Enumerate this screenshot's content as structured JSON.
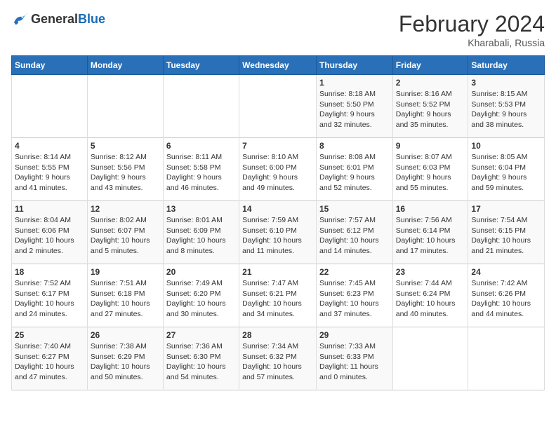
{
  "logo": {
    "general": "General",
    "blue": "Blue"
  },
  "title": "February 2024",
  "subtitle": "Kharabali, Russia",
  "days_header": [
    "Sunday",
    "Monday",
    "Tuesday",
    "Wednesday",
    "Thursday",
    "Friday",
    "Saturday"
  ],
  "weeks": [
    [
      {
        "day": "",
        "info": ""
      },
      {
        "day": "",
        "info": ""
      },
      {
        "day": "",
        "info": ""
      },
      {
        "day": "",
        "info": ""
      },
      {
        "day": "1",
        "info": "Sunrise: 8:18 AM\nSunset: 5:50 PM\nDaylight: 9 hours\nand 32 minutes."
      },
      {
        "day": "2",
        "info": "Sunrise: 8:16 AM\nSunset: 5:52 PM\nDaylight: 9 hours\nand 35 minutes."
      },
      {
        "day": "3",
        "info": "Sunrise: 8:15 AM\nSunset: 5:53 PM\nDaylight: 9 hours\nand 38 minutes."
      }
    ],
    [
      {
        "day": "4",
        "info": "Sunrise: 8:14 AM\nSunset: 5:55 PM\nDaylight: 9 hours\nand 41 minutes."
      },
      {
        "day": "5",
        "info": "Sunrise: 8:12 AM\nSunset: 5:56 PM\nDaylight: 9 hours\nand 43 minutes."
      },
      {
        "day": "6",
        "info": "Sunrise: 8:11 AM\nSunset: 5:58 PM\nDaylight: 9 hours\nand 46 minutes."
      },
      {
        "day": "7",
        "info": "Sunrise: 8:10 AM\nSunset: 6:00 PM\nDaylight: 9 hours\nand 49 minutes."
      },
      {
        "day": "8",
        "info": "Sunrise: 8:08 AM\nSunset: 6:01 PM\nDaylight: 9 hours\nand 52 minutes."
      },
      {
        "day": "9",
        "info": "Sunrise: 8:07 AM\nSunset: 6:03 PM\nDaylight: 9 hours\nand 55 minutes."
      },
      {
        "day": "10",
        "info": "Sunrise: 8:05 AM\nSunset: 6:04 PM\nDaylight: 9 hours\nand 59 minutes."
      }
    ],
    [
      {
        "day": "11",
        "info": "Sunrise: 8:04 AM\nSunset: 6:06 PM\nDaylight: 10 hours\nand 2 minutes."
      },
      {
        "day": "12",
        "info": "Sunrise: 8:02 AM\nSunset: 6:07 PM\nDaylight: 10 hours\nand 5 minutes."
      },
      {
        "day": "13",
        "info": "Sunrise: 8:01 AM\nSunset: 6:09 PM\nDaylight: 10 hours\nand 8 minutes."
      },
      {
        "day": "14",
        "info": "Sunrise: 7:59 AM\nSunset: 6:10 PM\nDaylight: 10 hours\nand 11 minutes."
      },
      {
        "day": "15",
        "info": "Sunrise: 7:57 AM\nSunset: 6:12 PM\nDaylight: 10 hours\nand 14 minutes."
      },
      {
        "day": "16",
        "info": "Sunrise: 7:56 AM\nSunset: 6:14 PM\nDaylight: 10 hours\nand 17 minutes."
      },
      {
        "day": "17",
        "info": "Sunrise: 7:54 AM\nSunset: 6:15 PM\nDaylight: 10 hours\nand 21 minutes."
      }
    ],
    [
      {
        "day": "18",
        "info": "Sunrise: 7:52 AM\nSunset: 6:17 PM\nDaylight: 10 hours\nand 24 minutes."
      },
      {
        "day": "19",
        "info": "Sunrise: 7:51 AM\nSunset: 6:18 PM\nDaylight: 10 hours\nand 27 minutes."
      },
      {
        "day": "20",
        "info": "Sunrise: 7:49 AM\nSunset: 6:20 PM\nDaylight: 10 hours\nand 30 minutes."
      },
      {
        "day": "21",
        "info": "Sunrise: 7:47 AM\nSunset: 6:21 PM\nDaylight: 10 hours\nand 34 minutes."
      },
      {
        "day": "22",
        "info": "Sunrise: 7:45 AM\nSunset: 6:23 PM\nDaylight: 10 hours\nand 37 minutes."
      },
      {
        "day": "23",
        "info": "Sunrise: 7:44 AM\nSunset: 6:24 PM\nDaylight: 10 hours\nand 40 minutes."
      },
      {
        "day": "24",
        "info": "Sunrise: 7:42 AM\nSunset: 6:26 PM\nDaylight: 10 hours\nand 44 minutes."
      }
    ],
    [
      {
        "day": "25",
        "info": "Sunrise: 7:40 AM\nSunset: 6:27 PM\nDaylight: 10 hours\nand 47 minutes."
      },
      {
        "day": "26",
        "info": "Sunrise: 7:38 AM\nSunset: 6:29 PM\nDaylight: 10 hours\nand 50 minutes."
      },
      {
        "day": "27",
        "info": "Sunrise: 7:36 AM\nSunset: 6:30 PM\nDaylight: 10 hours\nand 54 minutes."
      },
      {
        "day": "28",
        "info": "Sunrise: 7:34 AM\nSunset: 6:32 PM\nDaylight: 10 hours\nand 57 minutes."
      },
      {
        "day": "29",
        "info": "Sunrise: 7:33 AM\nSunset: 6:33 PM\nDaylight: 11 hours\nand 0 minutes."
      },
      {
        "day": "",
        "info": ""
      },
      {
        "day": "",
        "info": ""
      }
    ]
  ]
}
